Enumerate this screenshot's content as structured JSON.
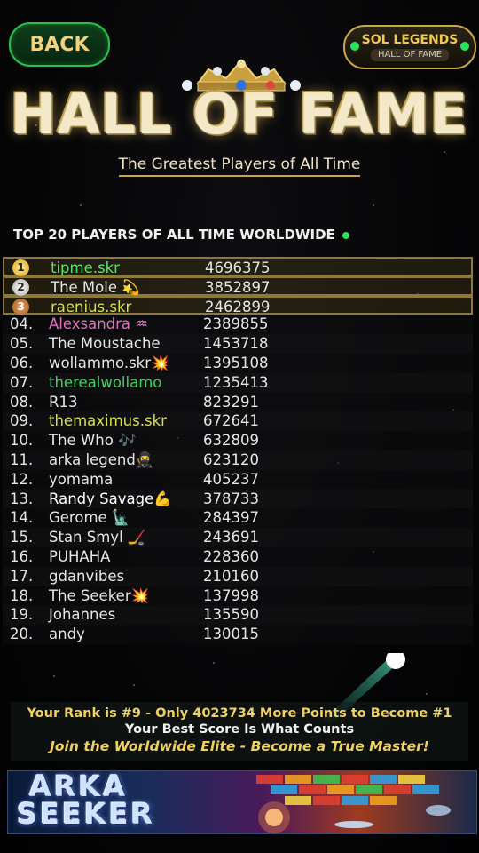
{
  "header": {
    "back_label": "BACK",
    "badge_title": "SOL LEGENDS",
    "badge_subtitle": "HALL OF FAME"
  },
  "title": "HALL OF FAME",
  "subtitle": "The Greatest Players of All Time",
  "section_title": "TOP 20 PLAYERS OF ALL TIME WORLDWIDE",
  "leaderboard": [
    {
      "rank": "1",
      "name": "tipme.skr",
      "score": "4696375",
      "color": "#5ee06a"
    },
    {
      "rank": "2",
      "name": "The Mole 💫",
      "score": "3852897",
      "color": "#e6e6e6"
    },
    {
      "rank": "3",
      "name": "raenius.skr",
      "score": "2462899",
      "color": "#d8e048"
    },
    {
      "rank": "04.",
      "name": "Alexsandra ♒",
      "score": "2389855",
      "color": "#e070c0"
    },
    {
      "rank": "05.",
      "name": "The Moustache",
      "score": "1453718",
      "color": "#e6e6e6"
    },
    {
      "rank": "06.",
      "name": "wollammo.skr💥",
      "score": "1395108",
      "color": "#e6e6e6"
    },
    {
      "rank": "07.",
      "name": "therealwollamo",
      "score": "1235413",
      "color": "#40d060"
    },
    {
      "rank": "08.",
      "name": "R13",
      "score": "823291",
      "color": "#e6e6e6"
    },
    {
      "rank": "09.",
      "name": "themaximus.skr",
      "score": "672641",
      "color": "#d8e048"
    },
    {
      "rank": "10.",
      "name": "The Who 🎶",
      "score": "632809",
      "color": "#e6e6e6"
    },
    {
      "rank": "11.",
      "name": "arka legend🥷",
      "score": "623120",
      "color": "#e6e6e6"
    },
    {
      "rank": "12.",
      "name": "yomama",
      "score": "405237",
      "color": "#e6e6e6"
    },
    {
      "rank": "13.",
      "name": "Randy Savage💪",
      "score": "378733",
      "color": "#ffffff"
    },
    {
      "rank": "14.",
      "name": "Gerome 🗽",
      "score": "284397",
      "color": "#e6e6e6"
    },
    {
      "rank": "15.",
      "name": "Stan Smyl 🏒",
      "score": "243691",
      "color": "#e6e6e6"
    },
    {
      "rank": "16.",
      "name": "PUHAHA",
      "score": "228360",
      "color": "#e6e6e6"
    },
    {
      "rank": "17.",
      "name": "gdanvibes",
      "score": "210160",
      "color": "#e6e6e6"
    },
    {
      "rank": "18.",
      "name": "The Seeker💥",
      "score": "137998",
      "color": "#e6e6e6"
    },
    {
      "rank": "19.",
      "name": "Johannes",
      "score": "135590",
      "color": "#e6e6e6"
    },
    {
      "rank": "20.",
      "name": "andy",
      "score": "130015",
      "color": "#e6e6e6"
    }
  ],
  "footer": {
    "rank_message": "Your Rank is #9 - Only 4023734 More Points to Become #1",
    "best_score_message": "Your Best Score Is What Counts",
    "elite_message": "Join the Worldwide Elite - Become a True Master!"
  },
  "banner": {
    "logo_line1": "ARKA",
    "logo_line2": "SEEKER"
  },
  "colors": {
    "accent_gold": "#c9a640",
    "accent_green": "#2be05a"
  }
}
